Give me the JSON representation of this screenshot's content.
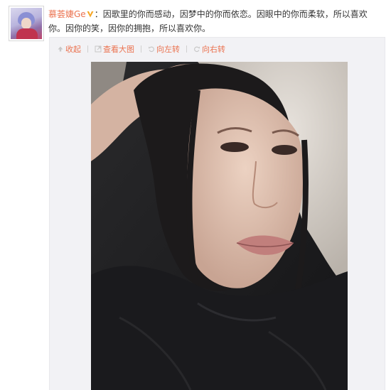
{
  "user": {
    "name": "慕荟婕Ge",
    "separator": "："
  },
  "post": {
    "text": "因歌里的你而感动，因梦中的你而依恋。因眼中的你而柔软，所以喜欢你。因你的笑，因你的拥抱，所以喜欢你。"
  },
  "toolbar": {
    "collapse_label": "收起",
    "view_large_label": "查看大图",
    "rotate_left_label": "向左转",
    "rotate_right_label": "向右转"
  },
  "colors": {
    "accent": "#eb7350",
    "vip_badge": "#f5a623",
    "media_bg": "#f2f2f5"
  },
  "icons": [
    "avatar",
    "vip-badge-icon",
    "collapse-arrow-icon",
    "view-large-icon",
    "rotate-left-icon",
    "rotate-right-icon"
  ]
}
